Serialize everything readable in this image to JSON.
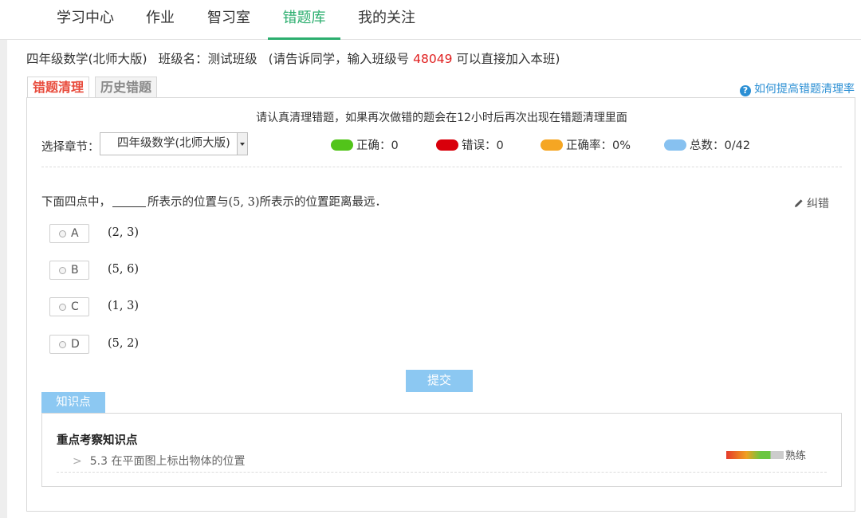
{
  "nav": {
    "tabs": [
      {
        "label": "学习中心"
      },
      {
        "label": "作业"
      },
      {
        "label": "智习室"
      },
      {
        "label": "错题库"
      },
      {
        "label": "我的关注"
      }
    ],
    "active_index": 3,
    "accent_color": "#2bae6e"
  },
  "class_info": {
    "course": "四年级数学(北师大版)",
    "class_name": "班级名：测试班级",
    "hint_prefix": "(请告诉同学，输入班级号",
    "class_code": "48049",
    "hint_suffix": "可以直接加入本班)"
  },
  "subtabs": [
    {
      "label": "错题清理",
      "active": true
    },
    {
      "label": "历史错题",
      "active": false
    }
  ],
  "help_link": {
    "icon": "question-circle-icon",
    "label": "如何提高错题清理率"
  },
  "notice": "请认真清理错题，如果再次做错的题会在12小时后再次出现在错题清理里面",
  "chapter": {
    "label": "选择章节：",
    "selected": "四年级数学(北师大版)"
  },
  "stats": [
    {
      "label": "正确：0",
      "color": "#52c41a"
    },
    {
      "label": "错误：0",
      "color": "#d9000b"
    },
    {
      "label": "正确率：0%",
      "color": "#f5a623"
    },
    {
      "label": "总数：0/42",
      "color": "#87c1f0"
    }
  ],
  "question": {
    "prefix": "下面四点中，",
    "middle": "所表示的位置与",
    "point": "(5, 3)",
    "suffix": "所表示的位置距离最远．",
    "correct_label": "纠错",
    "options": [
      {
        "letter": "A",
        "value": "(2, 3)"
      },
      {
        "letter": "B",
        "value": "(5, 6)"
      },
      {
        "letter": "C",
        "value": "(1, 3)"
      },
      {
        "letter": "D",
        "value": "(5, 2)"
      }
    ],
    "submit_label": "提交"
  },
  "knowledge": {
    "tab_label": "知识点",
    "title": "重点考察知识点",
    "item": "5.3 在平面图上标出物体的位置",
    "mastery_label": "熟练",
    "mastery_level": 0.77
  }
}
